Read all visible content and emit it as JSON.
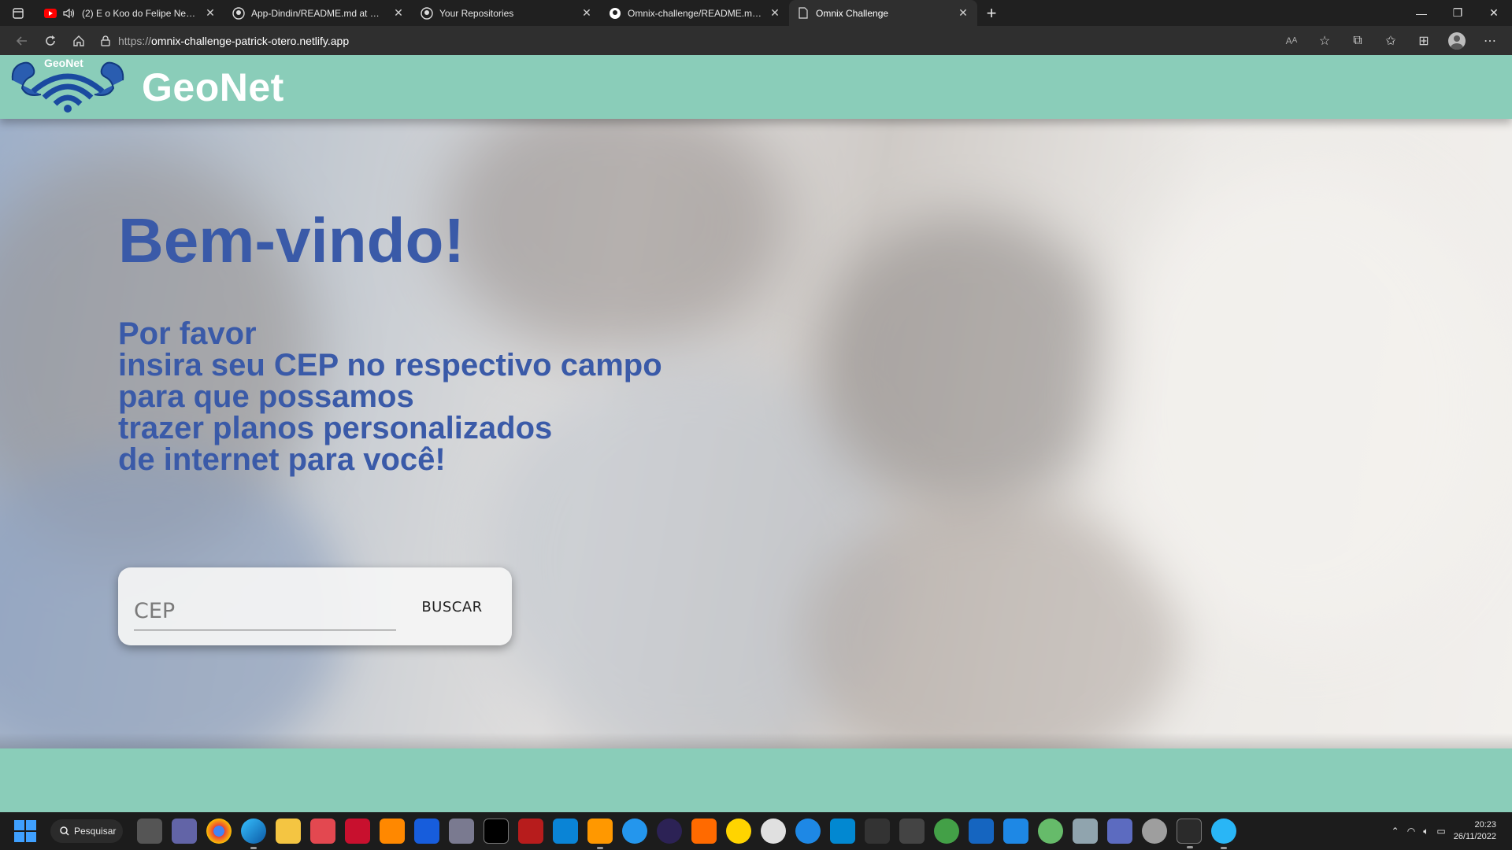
{
  "browser": {
    "tabs": [
      {
        "title": "(2) E o Koo do Felipe Neto?",
        "favicon": "youtube-icon",
        "active": false,
        "audio": true
      },
      {
        "title": "App-Dindin/README.md at main",
        "favicon": "github-icon",
        "active": false
      },
      {
        "title": "Your Repositories",
        "favicon": "github-icon",
        "active": false
      },
      {
        "title": "Omnix-challenge/README.md at",
        "favicon": "github-icon",
        "active": false
      },
      {
        "title": "Omnix Challenge",
        "favicon": "page-icon",
        "active": true
      }
    ],
    "url_prefix": "https://",
    "url_host": "omnix-challenge-patrick-otero.netlify.app"
  },
  "site": {
    "logo_text": "GeoNet",
    "brand_name": "GeoNet",
    "hero_title": "Bem-vindo!",
    "hero_lines": [
      "Por favor",
      "insira seu CEP no respectivo campo",
      "para que possamos",
      "trazer planos personalizados",
      "de internet para você!"
    ],
    "cep_placeholder": "CEP",
    "cep_value": "",
    "search_button": "BUSCAR"
  },
  "taskbar": {
    "search_label": "Pesquisar",
    "time": "20:23",
    "date": "26/11/2022"
  },
  "colors": {
    "header_green": "#8acdb9",
    "hero_blue": "#3a5aa8"
  }
}
